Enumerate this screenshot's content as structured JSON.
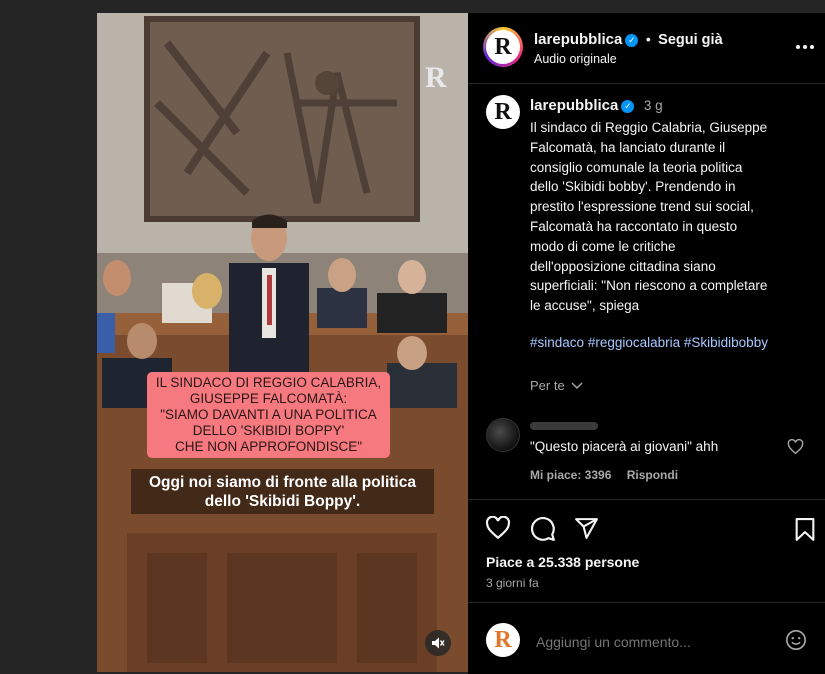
{
  "video": {
    "watermark": "R",
    "banner_lines": [
      "IL SINDACO DI REGGIO CALABRIA,",
      "GIUSEPPE FALCOMATÀ:",
      "\"SIAMO DAVANTI A UNA POLITICA",
      "DELLO 'SKIBIDI BOPPY'",
      "CHE NON APPROFONDISCE\""
    ],
    "subtitle_lines": [
      "Oggi noi siamo di fronte alla politica",
      "dello 'Skibidi Boppy'."
    ]
  },
  "header": {
    "username": "larepubblica",
    "separator": "•",
    "follow_label": "Segui già",
    "audio_label": "Audio originale",
    "avatar_letter": "R",
    "more_icon": "more-horizontal-icon"
  },
  "caption": {
    "username": "larepubblica",
    "time": "3 g",
    "avatar_letter": "R",
    "text_lines": [
      "Il sindaco di Reggio Calabria, Giuseppe",
      "Falcomatà, ha lanciato durante il",
      "consiglio comunale la teoria politica",
      "dello 'Skibidi bobby'. Prendendo in",
      "prestito l'espressione trend sui social,",
      "Falcomatà ha raccontato in questo",
      "modo di come le critiche",
      "dell'opposizione cittadina siano",
      "superficiali: \"Non riescono a completare",
      "le accuse\", spiega"
    ],
    "hashtags": [
      "#sindaco",
      "#reggiocalabria",
      "#Skibidibobby"
    ],
    "per_te_label": "Per te"
  },
  "comment": {
    "text": "\"Questo piacerà ai giovani\" ahh",
    "likes_label": "Mi piace: 3396",
    "reply_label": "Rispondi"
  },
  "actions": {
    "likes_label": "Piace a 25.338 persone",
    "date_label": "3 giorni fa"
  },
  "add_comment": {
    "placeholder": "Aggiungi un commento...",
    "avatar_letter": "R"
  },
  "colors": {
    "background": "#252525",
    "panel": "#000000",
    "verified": "#0095f6",
    "banner": "#f6797f",
    "hashtag": "#a6c8ff"
  }
}
